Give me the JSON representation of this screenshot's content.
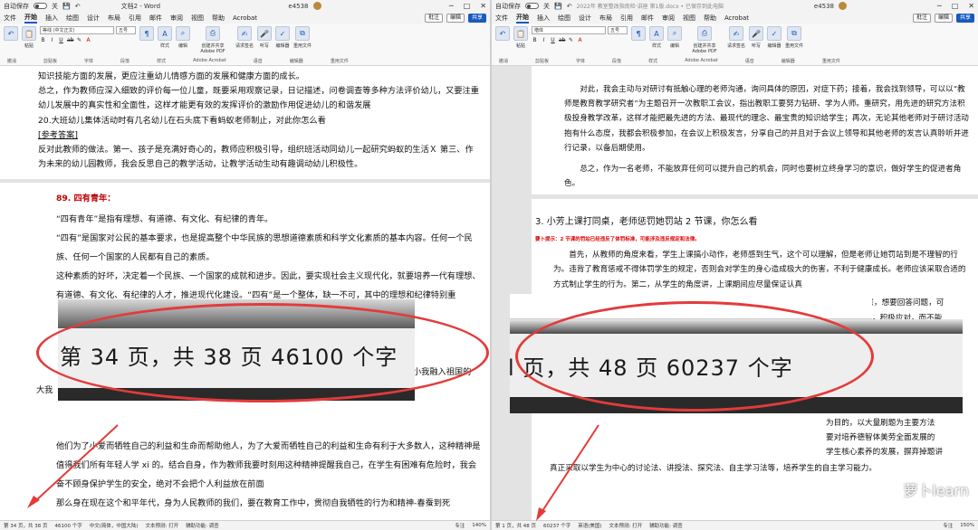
{
  "left": {
    "title": {
      "autosave": "自动保存",
      "toggle": "关",
      "doc": "文档2 - Word",
      "user": "e4538"
    },
    "menu": [
      "文件",
      "开始",
      "插入",
      "绘图",
      "设计",
      "布局",
      "引用",
      "邮件",
      "审阅",
      "视图",
      "帮助",
      "Acrobat"
    ],
    "menu_active": "开始",
    "buttons": {
      "comment": "批注",
      "edit": "编辑",
      "share": "共享"
    },
    "ribbon": {
      "font_name": "等线 (中文正文)",
      "font_size": "五号",
      "paste": "粘贴",
      "style": "样式",
      "editing": "编辑",
      "create_pdf": "创建并共享 Adobe PDF",
      "sign": "请求签名",
      "dictate": "听写",
      "editor": "编辑器",
      "reuse": "重用文件",
      "group_labels": [
        "撤消",
        "剪贴板",
        "字体",
        "段落",
        "样式",
        "Adobe Acrobat",
        "语音",
        "编辑器",
        "重用文件"
      ]
    },
    "body": [
      "知识技能方面的发展，更应注重幼儿情感方面的发展和健康方面的成长。",
      "总之，作为教师应深入细致的评价每一位儿童，既要采用观察记录，日记描述，问卷调查等多种方法评价幼儿，又要注重幼儿发展中的真实性和全面性，这样才能更有效的发挥评价的激励作用促进幼儿的和谐发展",
      "20.大班幼儿集体活动时有几名幼儿在石头底下看蚂蚁老师制止，对此你怎么看",
      "[参考答案]",
      "反对此教师的做法。第一、孩子是充满好奇心的，教师应积极引导，组织班活动同幼儿一起研究蚂蚁的生活Ｘ 第三、作为未来的幼儿园教师，我会反思自己的教学活动，让教学活动生动有趣调动幼儿积极性。"
    ],
    "heading": "89. 四有青年：",
    "body2": [
      "“四有青年”是指有理想、有道德、有文化、有纪律的青年。",
      "“四有”是国家对公民的基本要求，也是提高整个中华民族的思想道德素质和科学文化素质的基本内容。任何一个民族、任何一个国家的人民都有自己的素质。",
      "这种素质的好坏，决定着一个民族、一个国家的成就和进步。因此，要实现社会主义现代化，就要培养一代有理想、有道德、有文化、有纪律的人才，推进现代化建设。“四有”是一个整体，缺一不可，其中的理想和纪律特别重"
    ],
    "body_fragment_a": "小我融入祖国的",
    "body_fragment_b": "大我",
    "body3": [
      "他们为了小爱而牺牲自己的利益和生命而帮助他人，为了大爱而牺牲自己的利益和生命有利于大多数人，这种精神是值得我们所有年轻人学 xi 的。结合自身，作为教师我要时刻用这种精神提醒我自己，在学生有困难有危险时，我会奋不顾身保护学生的安全，绝对不会把个人利益放在前面",
      "那么身在现在这个和平年代，身为人民教师的我们，要在教育工作中，贯彻自我牺牲的行为和精神-春蚕到死"
    ],
    "zoom_stat": "第 34 页，共 38 页    46100 个字",
    "status": [
      "第 34 页，共 38 页",
      "46100 个字",
      "中文(简体，中国大陆)",
      "文本预测: 打开",
      "辅助功能: 调查",
      "专注",
      "140%"
    ]
  },
  "right": {
    "title": {
      "autosave": "自动保存",
      "toggle": "关",
      "doc": "2022年 教室整改指南检·讲座 第1版.docx • 已保存到此电脑",
      "user": "e4538"
    },
    "menu": [
      "文件",
      "开始",
      "插入",
      "绘图",
      "设计",
      "布局",
      "引用",
      "邮件",
      "审阅",
      "视图",
      "帮助",
      "Acrobat"
    ],
    "menu_active": "开始",
    "buttons": {
      "comment": "批注",
      "edit": "编辑",
      "share": "共享"
    },
    "ribbon": {
      "font_name": "楷体",
      "font_size": "五号",
      "paste": "粘贴",
      "style": "样式",
      "editing": "编辑",
      "create_pdf": "创建并共享 Adobe PDF",
      "sign": "请求签名",
      "dictate": "听写",
      "editor": "编辑器",
      "reuse": "重用文件",
      "group_labels": [
        "撤消",
        "剪贴板",
        "字体",
        "段落",
        "样式",
        "Adobe Acrobat",
        "语音",
        "编辑器",
        "重用文件"
      ]
    },
    "body": [
      "对此，我会主动与对研讨有抵触心理的老师沟通，询问具体的原因，对症下药；接着，我会找到领导，可以以“教师是教育教学研究者”为主题召开一次教职工会议，指出教职工要努力钻研、学为人师。重研究，用先进的研究方法积极投身教学改革，这样才能把最先进的方法、最现代的理念、最宝贵的知识给学生；再次，无论其他老师对于研讨活动抱有什么态度，我都会积极参加，在会议上积极发言，分享自己的并且对于会议上领导和其他老师的发言认真聆听并进行记录，以备后期使用。",
      "总之，作为一名老师，不能放弃任何可以提升自己的机会，同时也要树立终身学习的意识，做好学生的促进者角色。"
    ],
    "heading": "3. 小芳上课打同桌，老师惩罚她罚站 2 节课，你怎么看",
    "tip": "要卜提示：2 节课的罚站已经违反了体罚标准，可能涉及违反规定和法律。",
    "body2": [
      "首先，从教师的角度来看，学生上课搞小动作，老师感到生气，这个可以理解，但是老师让她罚站到是不理智的行为。违背了教育惩戒不得体罚学生的规定，否则会对学生的身心造成极大的伤害，不利于健康成长。老师应该采取合适的方式制止学生的行为。第二，从学生的角度讲，上课期间应尽量保证认真"
    ],
    "body_fragment_a": "老师的注意，想要回答问题，可",
    "body_fragment_b": "这理性分析，积极应对，而不能",
    "body3": [
      "为目的，以大量刷题为主要方法",
      "要对培养德智体美劳全面发展的",
      "学生核心素养的发展，摒弃掉题讲",
      "真正采取以学生为中心的讨论法、讲授法、探究法、自主学习法等，培养学生的自主学习能力。"
    ],
    "zoom_stat": "l 页，共 48 页    60237 个字",
    "status": [
      "第 1 页，共 48 页",
      "60237 个字",
      "英语(美国)",
      "文本预测: 打开",
      "辅助功能: 调查",
      "专注",
      "150%"
    ]
  },
  "watermark": "萝卜learn",
  "accent": "#185abd",
  "annotation_color": "#e33b3b"
}
